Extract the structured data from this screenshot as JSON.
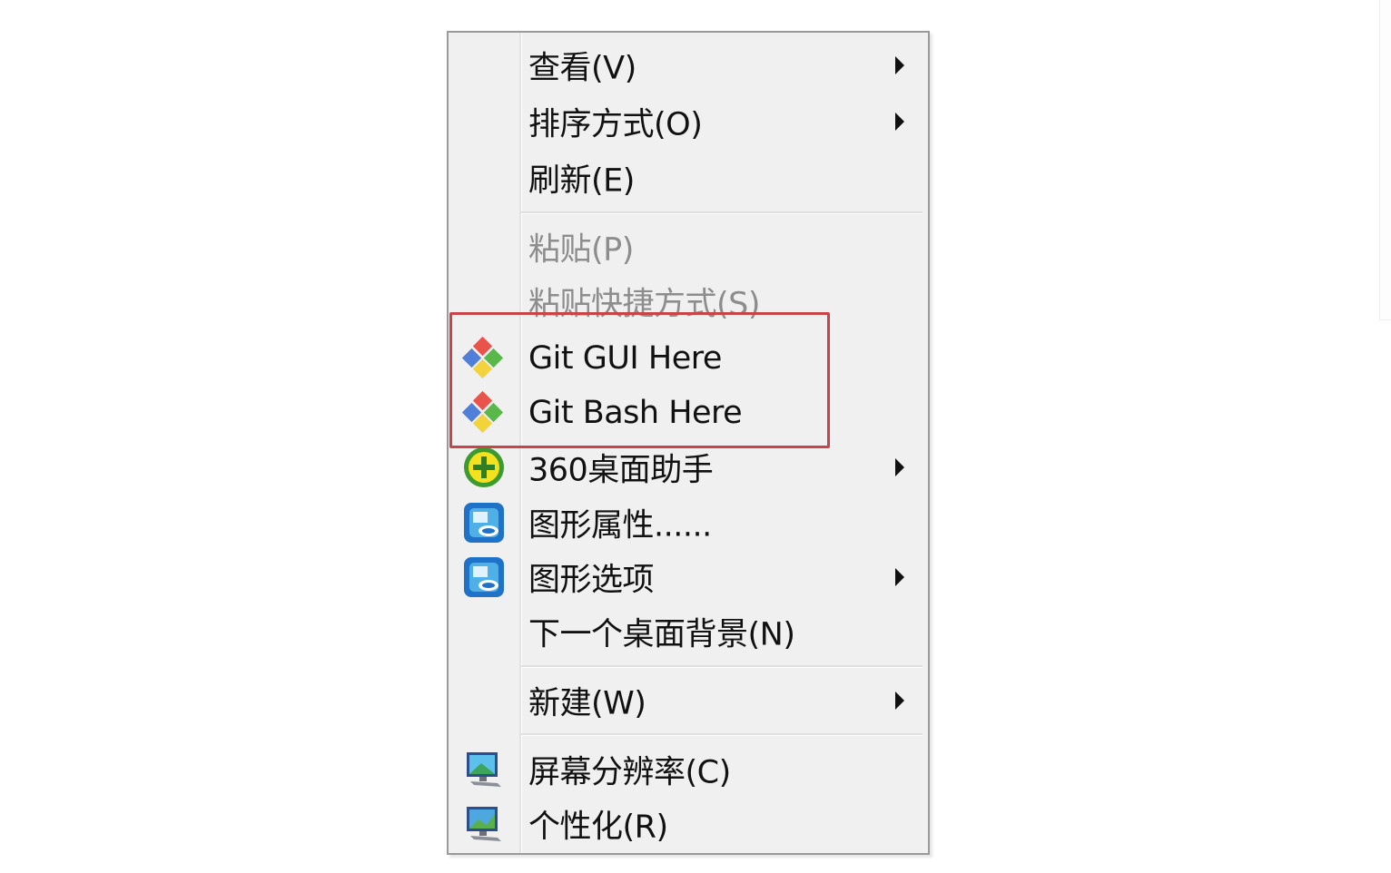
{
  "menu": {
    "items": [
      {
        "label": "查看(V)",
        "submenu": true,
        "enabled": true,
        "icon": null
      },
      {
        "label": "排序方式(O)",
        "submenu": true,
        "enabled": true,
        "icon": null
      },
      {
        "label": "刷新(E)",
        "submenu": false,
        "enabled": true,
        "icon": null
      },
      {
        "label": "粘贴(P)",
        "submenu": false,
        "enabled": false,
        "icon": null
      },
      {
        "label": "粘贴快捷方式(S)",
        "submenu": false,
        "enabled": false,
        "icon": null
      },
      {
        "label": "Git GUI Here",
        "submenu": false,
        "enabled": true,
        "icon": "git-icon"
      },
      {
        "label": "Git Bash Here",
        "submenu": false,
        "enabled": true,
        "icon": "git-icon"
      },
      {
        "label": "360桌面助手",
        "submenu": true,
        "enabled": true,
        "icon": "360-desktop-icon"
      },
      {
        "label": "图形属性......",
        "submenu": false,
        "enabled": true,
        "icon": "intel-graphics-icon"
      },
      {
        "label": "图形选项",
        "submenu": true,
        "enabled": true,
        "icon": "intel-graphics-icon"
      },
      {
        "label": "下一个桌面背景(N)",
        "submenu": false,
        "enabled": true,
        "icon": null
      },
      {
        "label": "新建(W)",
        "submenu": true,
        "enabled": true,
        "icon": null
      },
      {
        "label": "屏幕分辨率(C)",
        "submenu": false,
        "enabled": true,
        "icon": "monitor-icon"
      },
      {
        "label": "个性化(R)",
        "submenu": false,
        "enabled": true,
        "icon": "personalize-icon"
      }
    ]
  },
  "annotation": {
    "color": "#c8444a"
  }
}
